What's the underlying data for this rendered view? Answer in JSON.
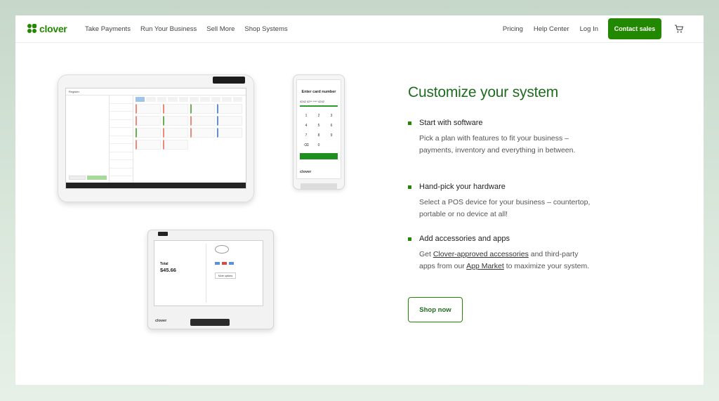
{
  "nav": {
    "logo_text": "clover",
    "links": [
      "Take Payments",
      "Run Your Business",
      "Sell More",
      "Shop Systems"
    ],
    "right_links": [
      "Pricing",
      "Help Center",
      "Log In"
    ],
    "contact_label": "Contact sales",
    "cart_icon": "cart-icon"
  },
  "devices": {
    "tablet": {
      "title": "Register"
    },
    "phone": {
      "title": "Enter card number",
      "card_mask": "4242 42** **** 4242",
      "keys": [
        "1",
        "2",
        "3",
        "4",
        "5",
        "6",
        "7",
        "8",
        "9",
        "⌫",
        "0",
        ""
      ],
      "brand": "clover"
    },
    "terminal": {
      "total_label": "Total",
      "total_value": "$45.66",
      "more_options": "More options",
      "brand": "clover"
    }
  },
  "content": {
    "heading": "Customize your system",
    "features": [
      {
        "title": "Start with software",
        "desc": "Pick a plan with features to fit your business – payments, inventory and everything in between."
      },
      {
        "title": "Hand-pick your hardware",
        "desc": "Select a POS device for your business – countertop, portable or no device at all!"
      },
      {
        "title": "Add accessories and apps",
        "desc_before": "Get ",
        "link1": "Clover-approved accessories",
        "desc_mid": " and third-party apps from our ",
        "link2": "App Market",
        "desc_after": " to maximize your system."
      }
    ],
    "shop_label": "Shop now"
  },
  "colors": {
    "brand_green": "#228800",
    "heading_green": "#1f6b1f"
  }
}
